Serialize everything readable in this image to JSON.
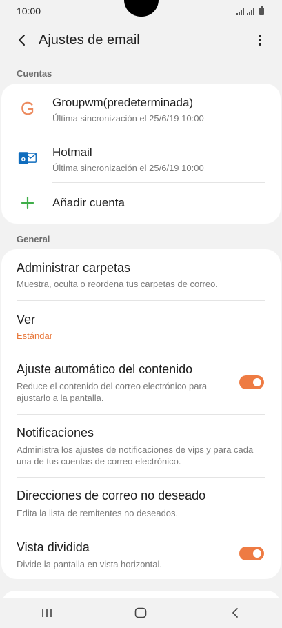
{
  "status_bar": {
    "time": "10:00"
  },
  "app_bar": {
    "title": "Ajustes de email"
  },
  "sections": {
    "accounts_header": "Cuentas",
    "general_header": "General"
  },
  "accounts": [
    {
      "name": "Groupwm(predeterminada)",
      "sync": "Última sincronización el 25/6/19  10:00",
      "icon": "g-letter-icon"
    },
    {
      "name": "Hotmail",
      "sync": "Última sincronización el 25/6/19  10:00",
      "icon": "outlook-icon"
    }
  ],
  "add_account": {
    "label": "Añadir cuenta",
    "icon": "plus-icon"
  },
  "general": {
    "manage_folders": {
      "title": "Administrar carpetas",
      "sub": "Muestra, oculta o reordena tus carpetas de correo."
    },
    "view": {
      "title": "Ver",
      "value": "Estándar"
    },
    "auto_fit": {
      "title": "Ajuste automático del contenido",
      "sub": "Reduce el contenido del correo electrónico para ajustarlo a la pantalla.",
      "enabled": true
    },
    "notifications": {
      "title": "Notificaciones",
      "sub": "Administra los ajustes de notificaciones de vips y para cada una de tus cuentas de correo electrónico."
    },
    "spam": {
      "title": "Direcciones de correo no deseado",
      "sub": "Edita la lista de remitentes no deseados."
    },
    "split_view": {
      "title": "Vista dividida",
      "sub": "Divide la pantalla en vista horizontal.",
      "enabled": true
    }
  },
  "colors": {
    "accent": "#ee7b43",
    "g_icon": "#ec8a5e",
    "add_icon": "#3fae49",
    "outlook": "#0f6cbd"
  }
}
